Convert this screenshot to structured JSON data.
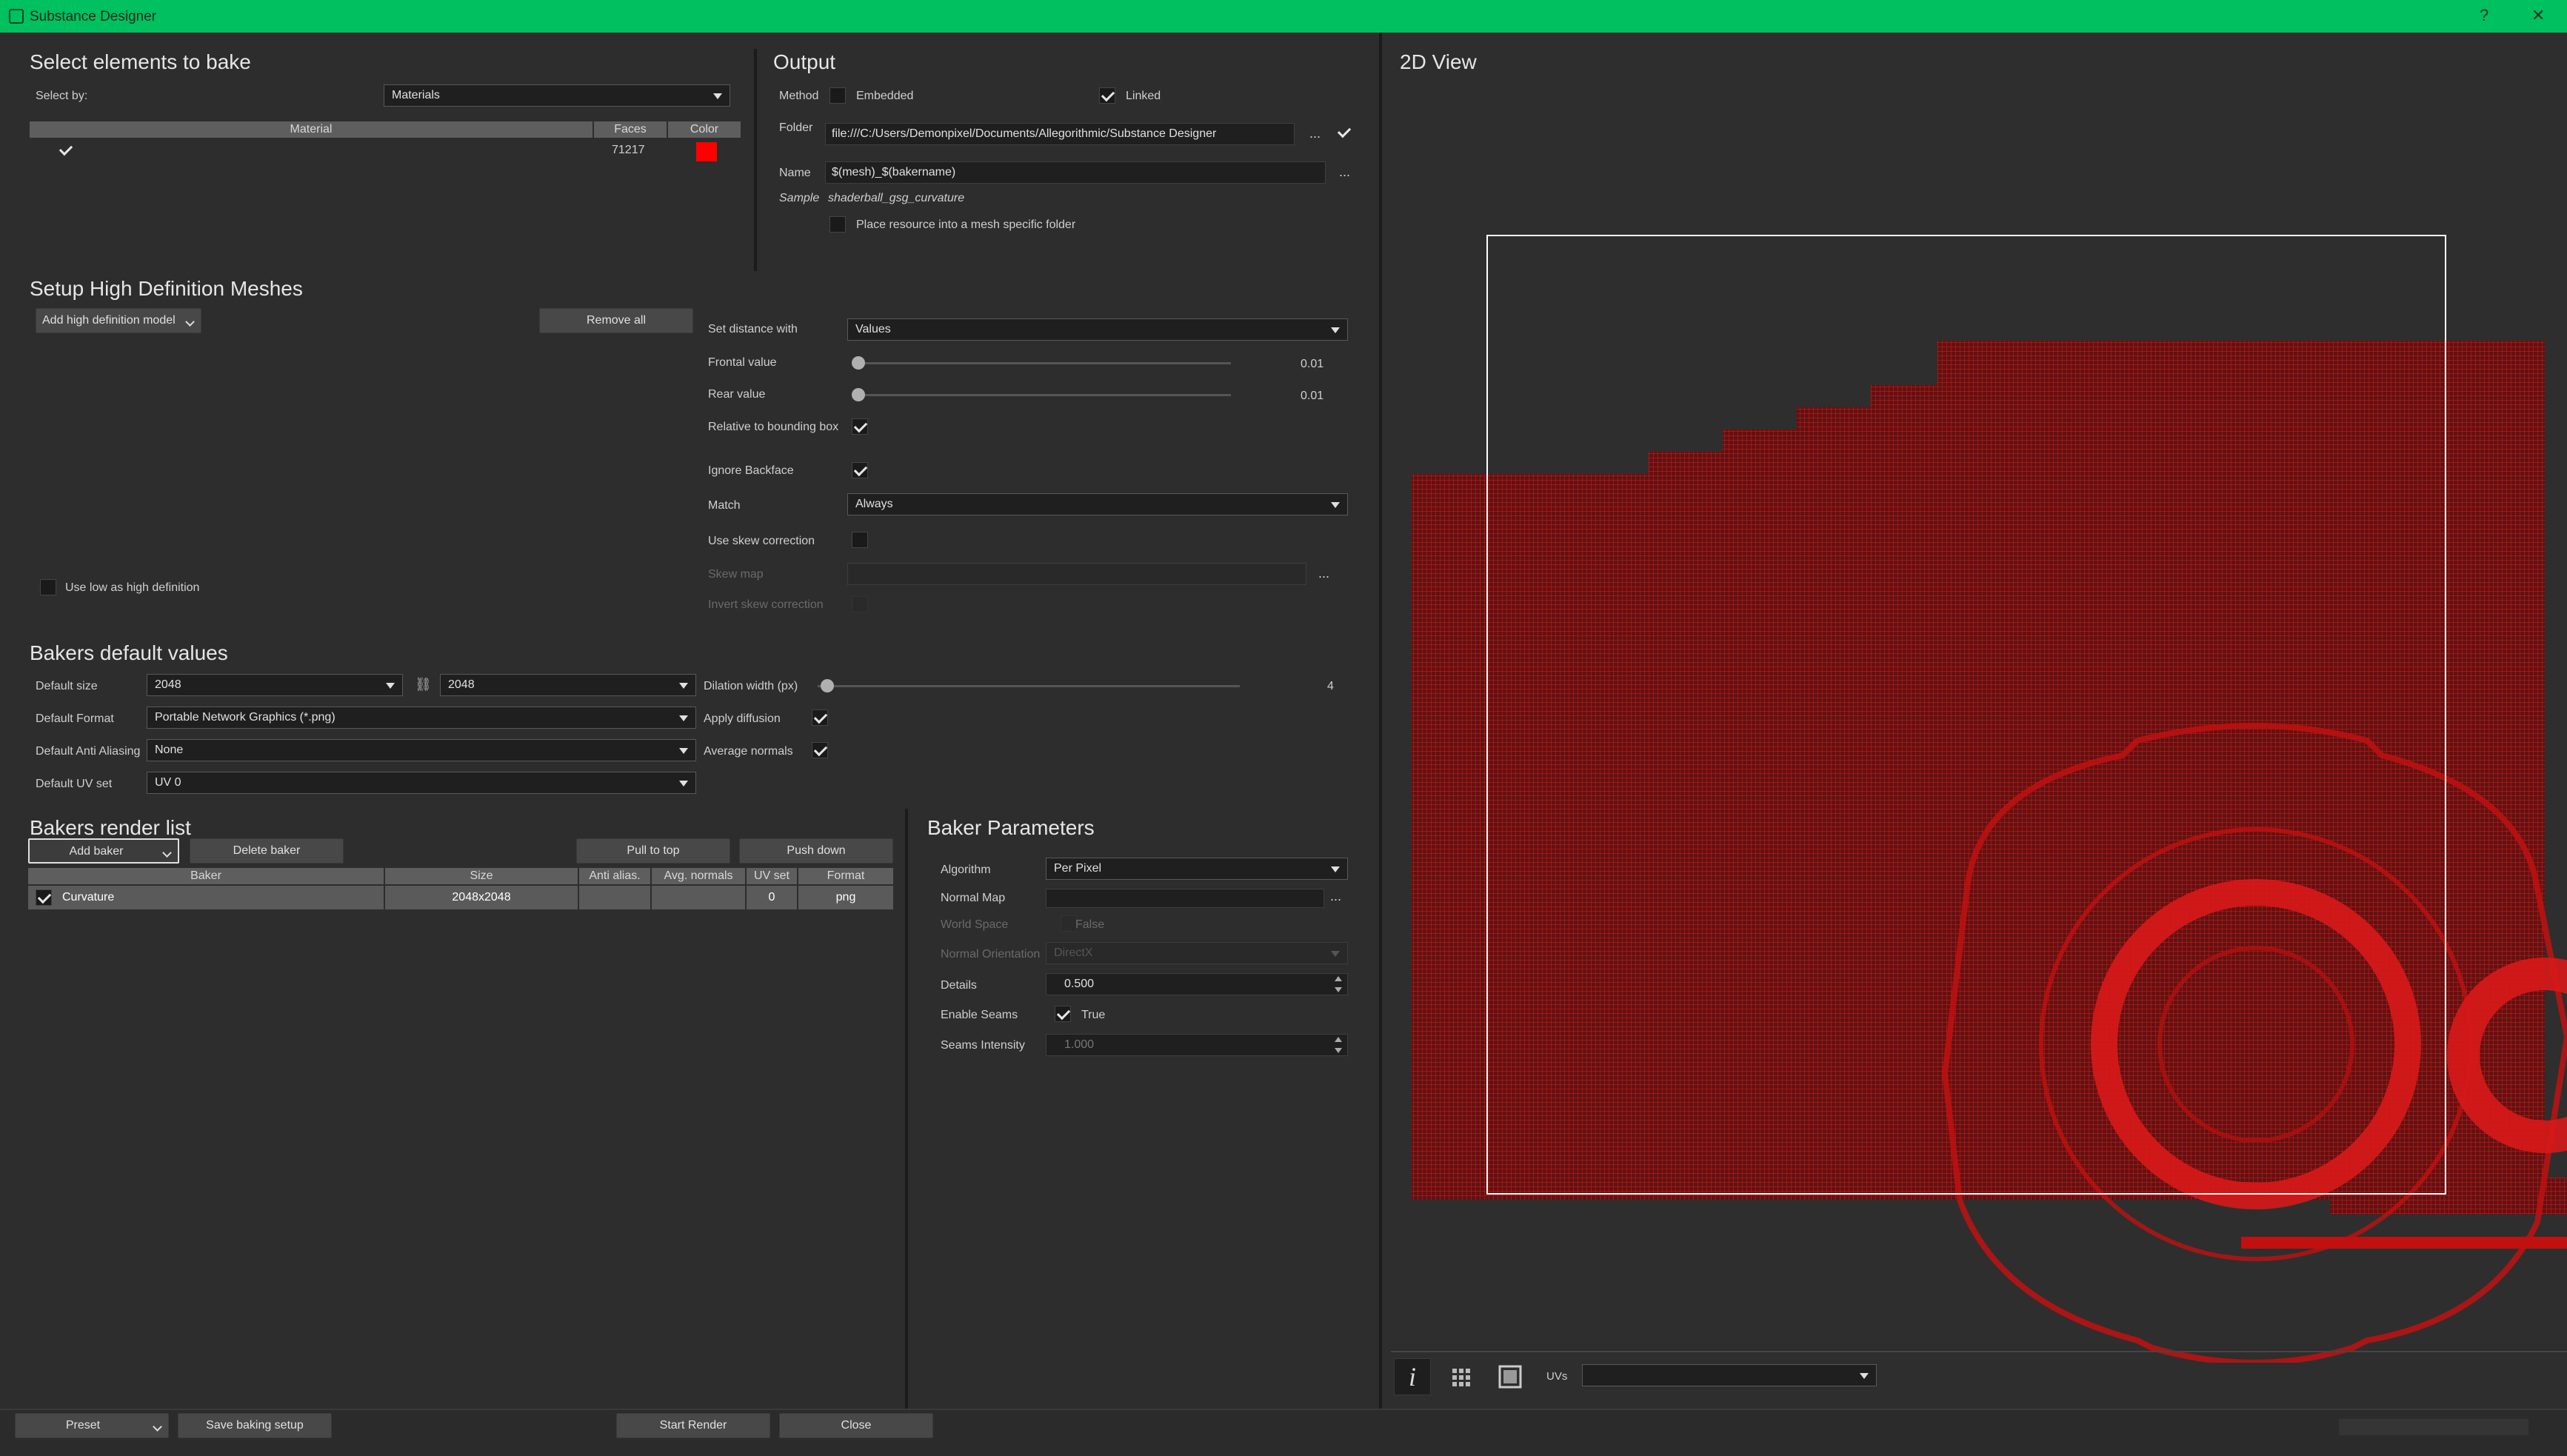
{
  "window": {
    "title": "Substance Designer",
    "help": "?",
    "close": "✕"
  },
  "select_elements": {
    "heading": "Select elements to bake",
    "select_by_label": "Select by:",
    "select_by_value": "Materials",
    "columns": [
      "Material",
      "Faces",
      "Color"
    ],
    "rows": [
      {
        "checked": true,
        "faces": "71217",
        "color": "#ff0000"
      }
    ]
  },
  "output": {
    "heading": "Output",
    "method_label": "Method",
    "embedded_label": "Embedded",
    "linked_label": "Linked",
    "folder_label": "Folder",
    "folder_value": "file:///C:/Users/Demonpixel/Documents/Allegorithmic/Substance Designer",
    "browse": "...",
    "name_label": "Name",
    "name_value": "$(mesh)_$(bakername)",
    "sample_label": "Sample",
    "sample_value": "shaderball_gsg_curvature",
    "place_resource_label": "Place resource into a mesh specific folder"
  },
  "hd_meshes": {
    "heading": "Setup High Definition Meshes",
    "add_model": "Add high definition model",
    "remove_all": "Remove all",
    "use_low_label": "Use low as high definition",
    "set_distance_label": "Set distance with",
    "set_distance_value": "Values",
    "frontal_label": "Frontal value",
    "frontal_value": "0.01",
    "rear_label": "Rear value",
    "rear_value": "0.01",
    "relative_bbox_label": "Relative to bounding box",
    "ignore_backface_label": "Ignore Backface",
    "match_label": "Match",
    "match_value": "Always",
    "skew_label": "Use skew correction",
    "skew_map_label": "Skew map",
    "invert_skew_label": "Invert skew correction"
  },
  "defaults": {
    "heading": "Bakers default values",
    "size_label": "Default size",
    "size_w": "2048",
    "size_h": "2048",
    "format_label": "Default Format",
    "format_value": "Portable Network Graphics (*.png)",
    "aa_label": "Default Anti Aliasing",
    "aa_value": "None",
    "uv_label": "Default UV set",
    "uv_value": "UV 0",
    "dilation_label": "Dilation width (px)",
    "dilation_value": "4",
    "apply_diffusion_label": "Apply diffusion",
    "avg_normals_label": "Average normals"
  },
  "render_list": {
    "heading": "Bakers render list",
    "add_baker": "Add baker",
    "delete_baker": "Delete baker",
    "pull_top": "Pull to top",
    "push_down": "Push down",
    "columns": [
      "Baker",
      "Size",
      "Anti alias.",
      "Avg. normals",
      "UV set",
      "Format"
    ],
    "row": {
      "name": "Curvature",
      "size": "2048x2048",
      "aa": "",
      "avg": "",
      "uv": "0",
      "format": "png"
    }
  },
  "baker_params": {
    "heading": "Baker Parameters",
    "algorithm_label": "Algorithm",
    "algorithm_value": "Per Pixel",
    "normal_map_label": "Normal Map",
    "world_space_label": "World Space",
    "world_space_value": "False",
    "normal_orient_label": "Normal Orientation",
    "normal_orient_value": "DirectX",
    "details_label": "Details",
    "details_value": "0.500",
    "enable_seams_label": "Enable Seams",
    "enable_seams_value": "True",
    "seams_intensity_label": "Seams Intensity",
    "seams_intensity_value": "1.000"
  },
  "view2d": {
    "heading": "2D View",
    "uvs_label": "UVs",
    "uvs_value": "",
    "info": "i"
  },
  "bottom": {
    "preset": "Preset",
    "save_setup": "Save baking setup",
    "start_render": "Start Render",
    "close": "Close"
  }
}
